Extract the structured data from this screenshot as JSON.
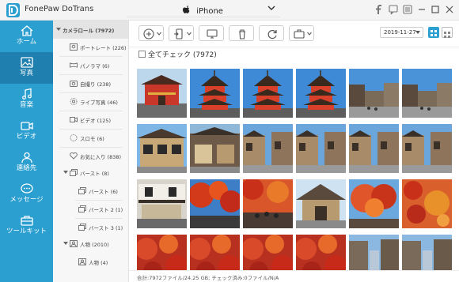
{
  "app": {
    "title": "FonePaw DoTrans",
    "device": "iPhone"
  },
  "colors": {
    "nav": "#2c9fd1",
    "nav_active": "#1f7fae",
    "accent": "#2c9fd1"
  },
  "nav": [
    {
      "label": "ホーム",
      "icon": "home-icon"
    },
    {
      "label": "写真",
      "icon": "photo-icon",
      "active": true
    },
    {
      "label": "音楽",
      "icon": "music-icon"
    },
    {
      "label": "ビデオ",
      "icon": "video-icon"
    },
    {
      "label": "連絡先",
      "icon": "contacts-icon"
    },
    {
      "label": "メッセージ",
      "icon": "message-icon"
    },
    {
      "label": "ツールキット",
      "icon": "toolkit-icon"
    }
  ],
  "albums": {
    "root": "カメラロール (7972)",
    "items": [
      {
        "label": "ポートレート (226)",
        "icon": "portrait-icon"
      },
      {
        "label": "パノラマ (6)",
        "icon": "panorama-icon"
      },
      {
        "label": "自撮り (238)",
        "icon": "selfie-icon"
      },
      {
        "label": "ライブ写真 (46)",
        "icon": "live-photo-icon"
      },
      {
        "label": "ビデオ (125)",
        "icon": "video-icon"
      },
      {
        "label": "スロモ (6)",
        "icon": "slomo-icon"
      },
      {
        "label": "お気に入り (838)",
        "icon": "heart-icon"
      }
    ],
    "burst": {
      "label": "バースト (8)",
      "children": [
        "バースト (6)",
        "バースト 2 (1)",
        "バースト 3 (1)"
      ]
    },
    "people": {
      "label": "人物 (2010)",
      "children": [
        "人物 (4)"
      ]
    }
  },
  "toolbar": {
    "buttons": [
      "add-icon",
      "export-to-device-icon",
      "export-to-pc-icon",
      "delete-icon",
      "refresh-icon",
      "toolbox-icon"
    ],
    "date": "2019-11-27",
    "view_modes": [
      "grid-view-icon",
      "list-view-icon"
    ]
  },
  "select_all": "全てチェック (7972)",
  "status": "合計:7972ファイル/24.25 GB; チェック済み:0ファイル/N/A",
  "thumbnails": [
    "pagoda-gate",
    "pagoda",
    "pagoda",
    "pagoda",
    "street-blue-sky",
    "street-blue-sky",
    "wooden-house",
    "shop-front",
    "wooden-street",
    "wooden-street",
    "wooden-street",
    "wooden-street",
    "building-white",
    "autumn-maple",
    "autumn-crowd",
    "temple-roof",
    "autumn-tree",
    "autumn-leaves",
    "autumn-red",
    "autumn-red",
    "autumn-red",
    "autumn-red",
    "alley",
    "alley"
  ]
}
